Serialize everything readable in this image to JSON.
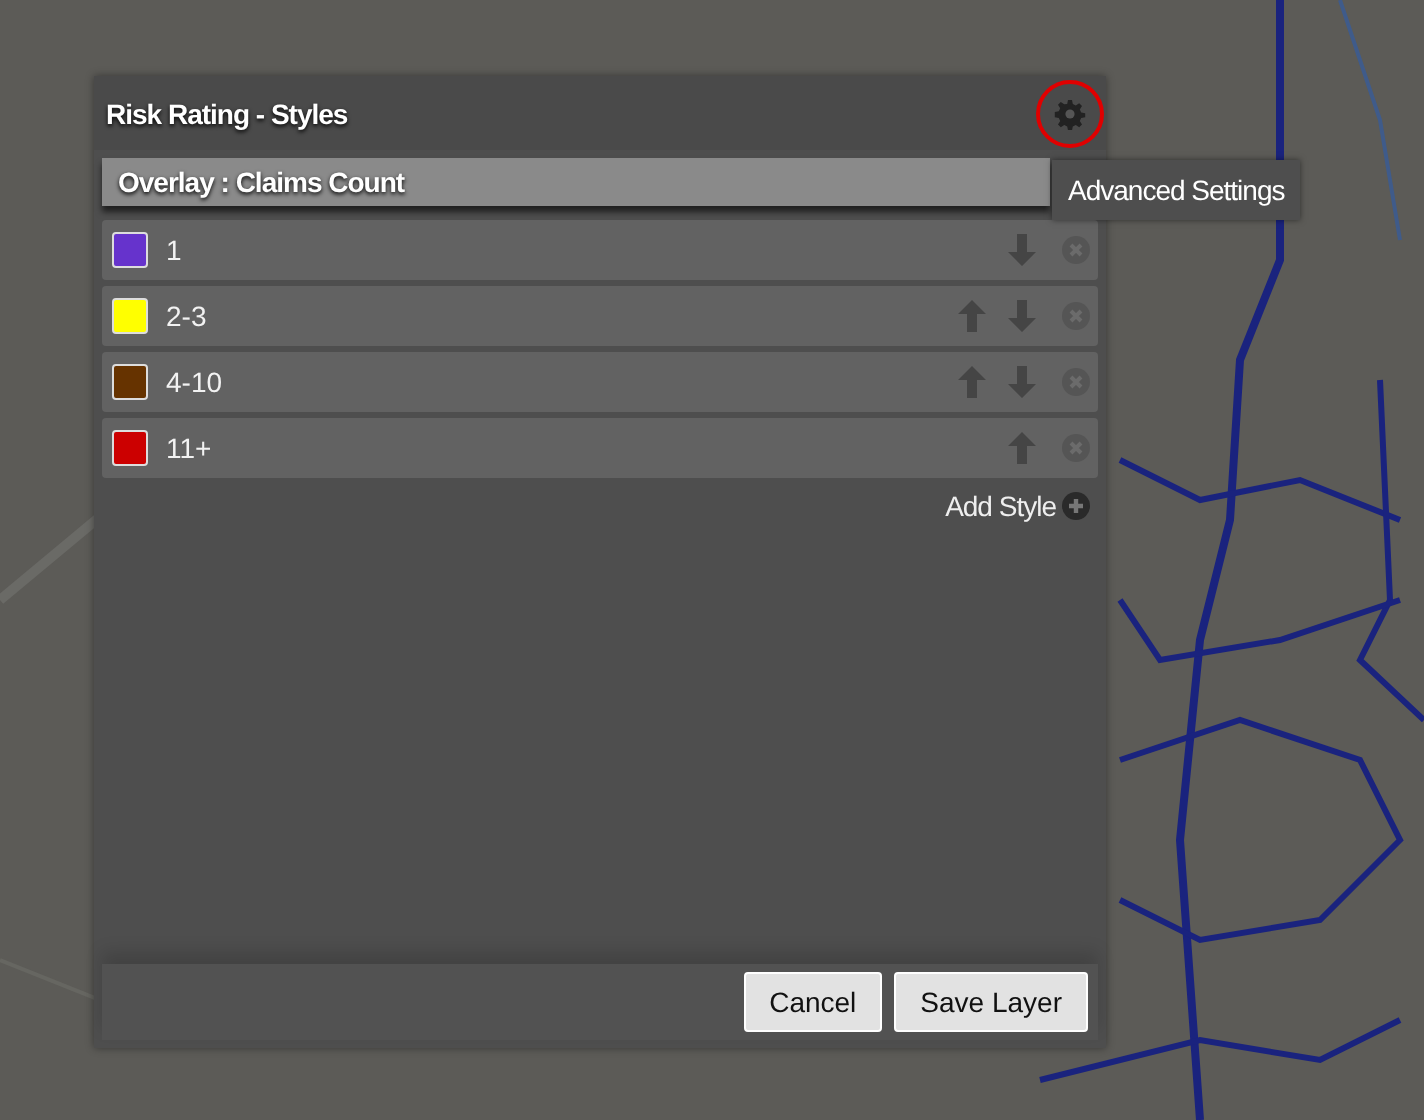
{
  "dialog": {
    "title": "Risk Rating - Styles",
    "settings_button": {
      "highlighted": true
    },
    "tooltip": "Advanced Settings"
  },
  "overlay": {
    "label": "Overlay : Claims Count"
  },
  "styles": [
    {
      "label": "1",
      "color": "#6633cc",
      "up": false,
      "down": true
    },
    {
      "label": "2-3",
      "color": "#ffff00",
      "up": true,
      "down": true
    },
    {
      "label": "4-10",
      "color": "#663300",
      "up": true,
      "down": true
    },
    {
      "label": "11+",
      "color": "#cc0000",
      "up": true,
      "down": false
    }
  ],
  "add_style": "Add Style",
  "buttons": [
    {
      "label": "Cancel"
    },
    {
      "label": "Save Layer"
    }
  ]
}
